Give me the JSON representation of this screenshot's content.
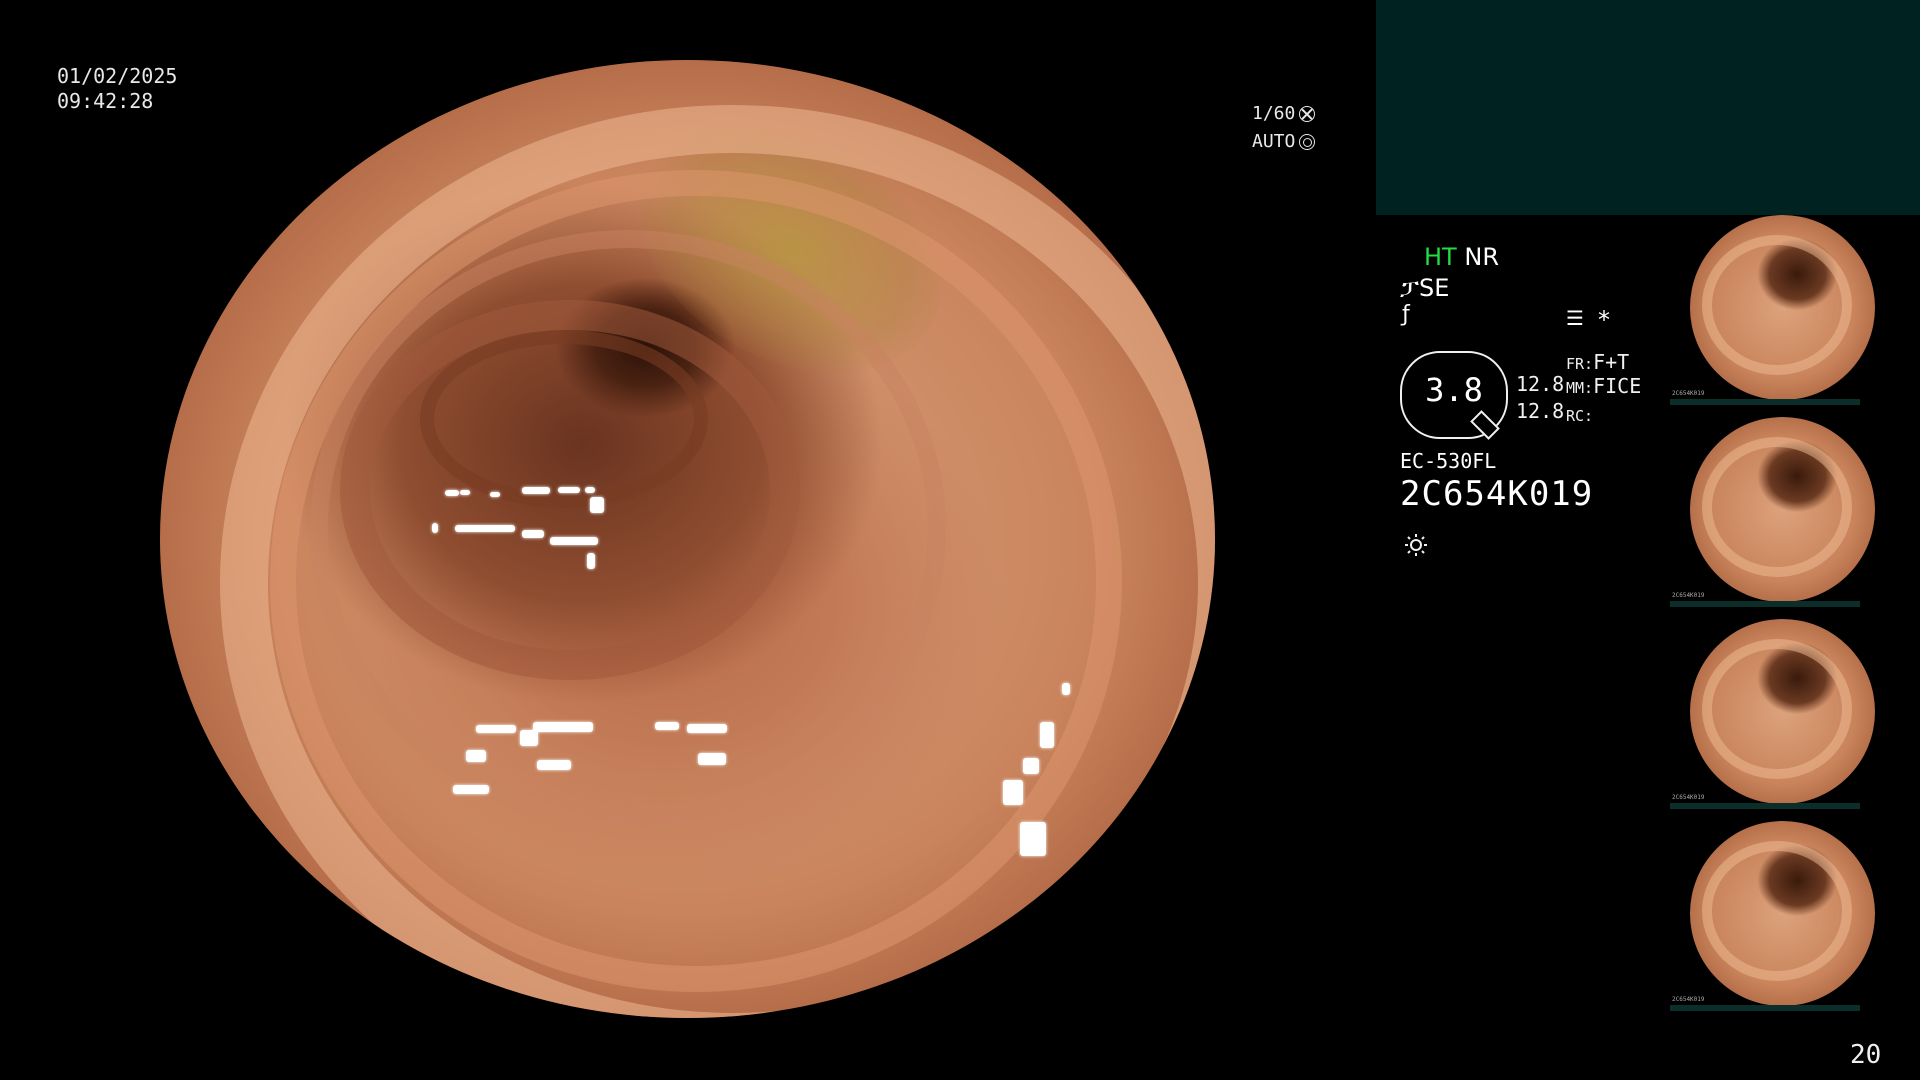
{
  "overlay": {
    "date": "01/02/2025",
    "time": "09:42:28",
    "shutter_speed": "1/60",
    "exposure_mode": "AUTO"
  },
  "settings": {
    "mode_ht": "HT",
    "mode_nr": "NR",
    "mode_se": "SE",
    "se_symbol": "ፓ",
    "color_symbol": "ƒ",
    "memo_symbol": "☰",
    "asterisk": "*",
    "zoom_value": "3.8",
    "enhance_value_1": "12.8",
    "enhance_value_2": "12.8",
    "fr_label": "FR:",
    "fr_value": "F+T",
    "mm_label": "MM:",
    "mm_value": "FICE",
    "rc_label": "RC:",
    "rc_value": ""
  },
  "scope": {
    "model": "EC-530FL",
    "serial": "2C654K019"
  },
  "icons": {
    "shutter": "aperture-icon",
    "exposure": "target-icon",
    "light": "sun-icon"
  },
  "colors": {
    "highlight_green": "#22dd44",
    "top_panel": "#002220"
  },
  "page_number": "20",
  "thumbnails": [
    {
      "serial": "2C654K019"
    },
    {
      "serial": "2C654K019"
    },
    {
      "serial": "2C654K019"
    },
    {
      "serial": "2C654K019"
    }
  ]
}
